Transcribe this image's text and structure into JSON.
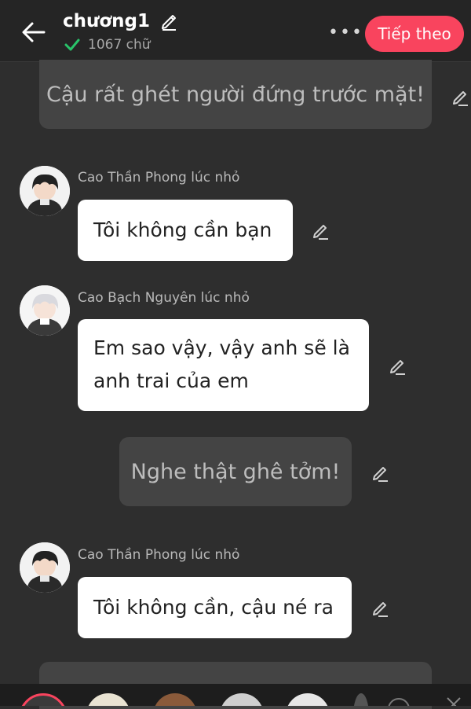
{
  "header": {
    "title": "chương1",
    "word_count": "1067 chữ",
    "more_label": "•••",
    "next_label": "Tiếp theo",
    "next_color": "#f9445e"
  },
  "messages": {
    "n1": "Cậu rất ghét người đứng trước mặt!",
    "d1": {
      "speaker": "Cao Thần Phong lúc nhỏ",
      "text": "Tôi không cần bạn"
    },
    "d2": {
      "speaker": "Cao Bạch Nguyên lúc nhỏ",
      "line1": "Em sao vậy, vậy anh sẽ là",
      "line2": "anh trai của em"
    },
    "n2": "Nghe thật ghê tởm!",
    "d3": {
      "speaker": "Cao Thần Phong lúc nhỏ",
      "text": "Tôi không cần, cậu né ra"
    }
  },
  "icons": {
    "back": "arrow-left-icon",
    "edit": "pencil-icon",
    "saved": "check-icon"
  }
}
